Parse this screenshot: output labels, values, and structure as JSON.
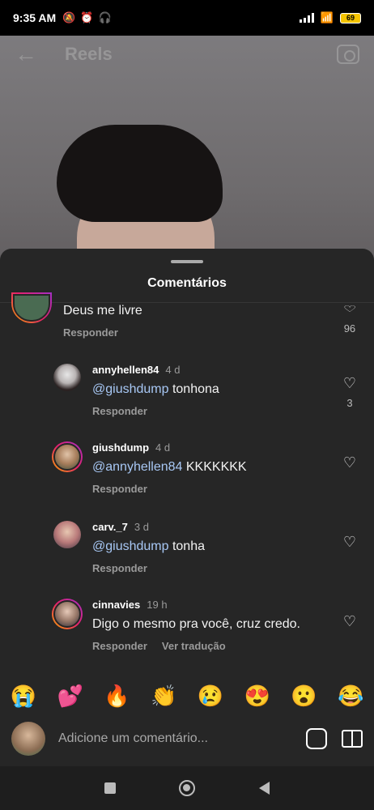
{
  "status_bar": {
    "time": "9:35 AM",
    "battery": "69"
  },
  "header": {
    "title": "Reels"
  },
  "sheet": {
    "title": "Comentários"
  },
  "comments": [
    {
      "username": "",
      "time": "",
      "mention": "",
      "text": "Deus me livre",
      "reply_label": "Responder",
      "likes": "96"
    },
    {
      "username": "annyhellen84",
      "time": "4 d",
      "mention": "@giushdump",
      "text": " tonhona",
      "reply_label": "Responder",
      "likes": "3"
    },
    {
      "username": "giushdump",
      "time": "4 d",
      "mention": "@annyhellen84",
      "text": " KKKKKKK",
      "reply_label": "Responder",
      "likes": ""
    },
    {
      "username": "carv._7",
      "time": "3 d",
      "mention": "@giushdump",
      "text": " tonha",
      "reply_label": "Responder",
      "likes": ""
    },
    {
      "username": "cinnavies",
      "time": "19 h",
      "mention": "",
      "text": "Digo o mesmo pra você, cruz credo.",
      "reply_label": "Responder",
      "translate_label": "Ver tradução",
      "likes": ""
    }
  ],
  "emojis": [
    "😭",
    "💕",
    "🔥",
    "👏",
    "😢",
    "😍",
    "😮",
    "😂"
  ],
  "input": {
    "placeholder": "Adicione um comentário..."
  },
  "icons": {
    "back": "back-arrow-icon",
    "camera": "camera-icon",
    "heart": "heart-icon",
    "sticker": "sticker-icon",
    "gift": "gift-icon"
  },
  "colors": {
    "sheet_bg": "#262626",
    "mention": "#a8c8f5",
    "muted": "#9a9a9a"
  }
}
